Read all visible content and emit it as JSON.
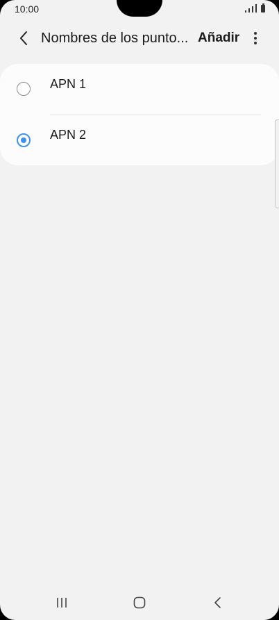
{
  "status_bar": {
    "time": "10:00"
  },
  "app_bar": {
    "title": "Nombres de los punto...",
    "add_label": "Añadir",
    "back_icon": "chevron-left-icon",
    "more_icon": "more-vertical-icon"
  },
  "apn_list": {
    "items": [
      {
        "label": "APN 1",
        "selected": false
      },
      {
        "label": "APN 2",
        "selected": true
      }
    ]
  },
  "colors": {
    "accent": "#3e91f0",
    "background": "#f2f2f2",
    "card": "#fcfcfc"
  },
  "nav_bar": {
    "recent_icon": "recent-apps-icon",
    "home_icon": "home-icon",
    "back_icon": "back-icon"
  }
}
